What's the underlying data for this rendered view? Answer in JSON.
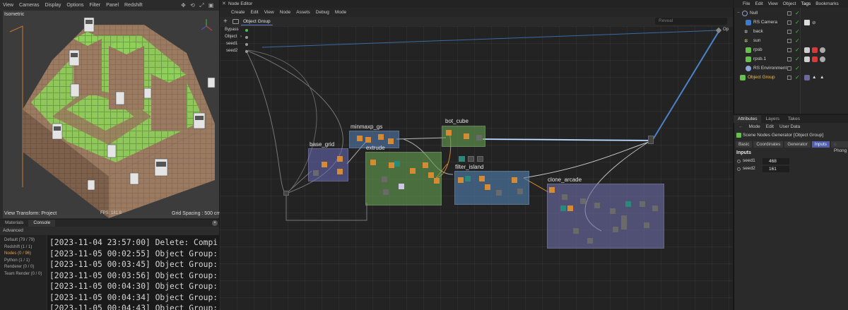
{
  "viewport": {
    "menu": [
      "View",
      "Cameras",
      "Display",
      "Options",
      "Filter",
      "Panel",
      "Redshift"
    ],
    "camera_label": "Isometric",
    "fps": "FPS: 181.8",
    "view_transform": "View Transform: Project",
    "grid_spacing": "Grid Spacing : 500 cm"
  },
  "console": {
    "tabs": [
      "Materials",
      "Console"
    ],
    "active_tab": "Console",
    "filter_label": "Advanced",
    "categories": [
      "Default (79 / 79)",
      "Redshift (1 / 1)",
      "Nodes (0 / 96)",
      "Python (1 / 1)",
      "Renderer (0 / 0)",
      "Team Render  (0 / 0)"
    ],
    "active_category": "Nodes (0 / 96)",
    "log": [
      "[2023-11-04 23:57:00] Delete: Compi",
      "[2023-11-05 00:02:55] Object Group:",
      "[2023-11-05 00:03:45] Object Group:",
      "[2023-11-05 00:03:56] Object Group:",
      "[2023-11-05 00:04:30] Object Group:",
      "[2023-11-05 00:04:34] Object Group:",
      "[2023-11-05 00:04:43] Object Group:"
    ]
  },
  "node_editor": {
    "title": "Node Editor",
    "menu": [
      "Create",
      "Edit",
      "View",
      "Node",
      "Assets",
      "Debug",
      "Mode"
    ],
    "tab": "Object Group",
    "reveal_placeholder": "Reveal",
    "ports": [
      "Bypass",
      "Object",
      "seed1",
      "seed2"
    ],
    "output_port": "Op",
    "groups": {
      "base_grid": "base_grid",
      "minmaxp_gs": "minmaxp_gs",
      "extrude": "extrude",
      "bot_cube": "bot_cube",
      "filter_island": "filter_island",
      "clone_arcade": "clone_arcade"
    }
  },
  "object_manager": {
    "menu": [
      "File",
      "Edit",
      "View",
      "Object",
      "Tags",
      "Bookmarks"
    ],
    "active_menu": "Tags",
    "rows": [
      {
        "name": "Null",
        "icon": "null-icon"
      },
      {
        "name": "RS Camera",
        "icon": "camera-icon"
      },
      {
        "name": "back",
        "icon": "light-icon"
      },
      {
        "name": "sun",
        "icon": "light-icon"
      },
      {
        "name": "rpsb",
        "icon": "object-icon"
      },
      {
        "name": "rpsb.1",
        "icon": "object-icon"
      },
      {
        "name": "RS Environment",
        "icon": "environment-icon"
      },
      {
        "name": "Object Group",
        "icon": "generator-icon"
      }
    ]
  },
  "attributes": {
    "tabs": [
      "Attributes",
      "Layers",
      "Takes"
    ],
    "active_tab": "Attributes",
    "menu": [
      "Mode",
      "Edit",
      "User Data"
    ],
    "title": "Scene Nodes Generator [Object Group]",
    "subtabs": [
      "Basic",
      "Coordinates",
      "Generator",
      "Inputs",
      "Phong"
    ],
    "active_subtab": "Inputs",
    "section": "Inputs",
    "seed1_label": "seed1",
    "seed1_value": "468",
    "seed2_label": "seed2",
    "seed2_value": "161"
  },
  "colors": {
    "accent": "#4f5fae",
    "nodes_orange": "#d68a32",
    "group_purple": "#5a5c9a",
    "group_green": "#5b8d4a",
    "group_blue": "#3f6c94",
    "wire_blue": "#5e8fcf"
  }
}
